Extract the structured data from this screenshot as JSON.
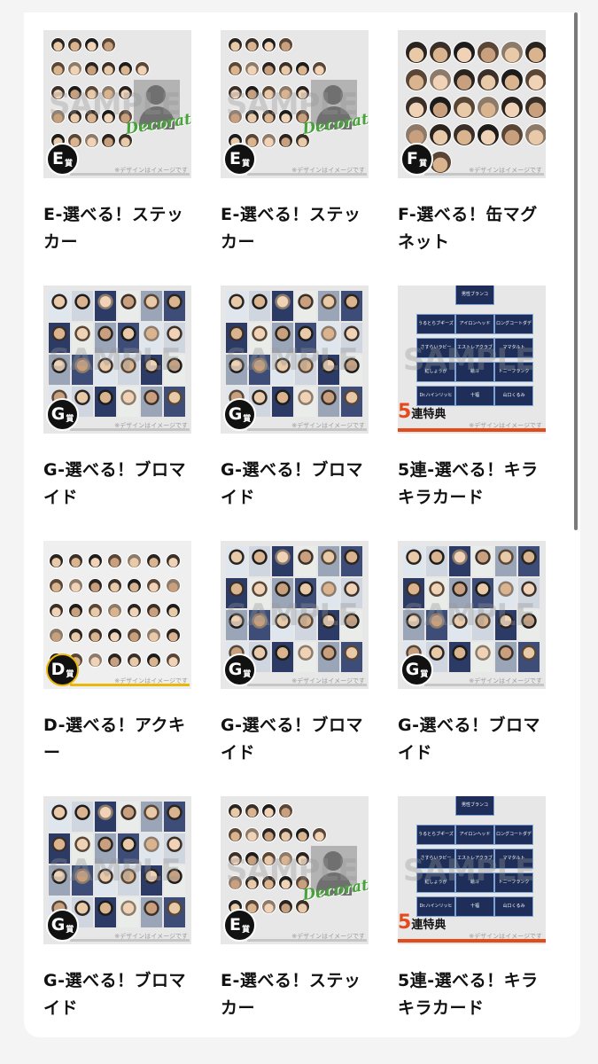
{
  "note_text": "※デザインはイメージです",
  "watermark": "SAMPLE",
  "decoration_label": "Decoration",
  "prize_suffix": "賞",
  "bonus": {
    "number": "5",
    "text": "連特典"
  },
  "colors": {
    "bonus_accent": "#e54b1a",
    "gold": "#e9b80a",
    "badge": "#111111",
    "decoration_green": "#48a33a",
    "card_navy": "#1e2e58"
  },
  "card_names": [
    "男性ブランコ",
    "うるとらブギーズ",
    "アイロンヘッド",
    "ロングコートダディ",
    "さすらいラビー",
    "エストレアクラブ",
    "ママタルト",
    "紅しょうが",
    "絵斗",
    "トニーフランク",
    "Dr.ハインリッヒ",
    "十福",
    "山口くるみ"
  ],
  "products": [
    {
      "prize": "E",
      "type": "sticker",
      "title": "E-選べる！ステッカー"
    },
    {
      "prize": "E",
      "type": "sticker",
      "title": "E-選べる！ステッカー"
    },
    {
      "prize": "F",
      "type": "magnet",
      "title": "F-選べる！缶マグネット"
    },
    {
      "prize": "G",
      "type": "bromide",
      "title": "G-選べる！ブロマイド"
    },
    {
      "prize": "G",
      "type": "bromide",
      "title": "G-選べる！ブロマイド"
    },
    {
      "prize": "",
      "type": "cards",
      "title": "5連-選べる！キラキラカード"
    },
    {
      "prize": "D",
      "type": "acrylic",
      "title": "D-選べる！アクキー"
    },
    {
      "prize": "G",
      "type": "bromide",
      "title": "G-選べる！ブロマイド"
    },
    {
      "prize": "G",
      "type": "bromide",
      "title": "G-選べる！ブロマイド"
    },
    {
      "prize": "G",
      "type": "bromide",
      "title": "G-選べる！ブロマイド"
    },
    {
      "prize": "E",
      "type": "sticker",
      "title": "E-選べる！ステッカー"
    },
    {
      "prize": "",
      "type": "cards",
      "title": "5連-選べる！キラキラカード"
    }
  ]
}
